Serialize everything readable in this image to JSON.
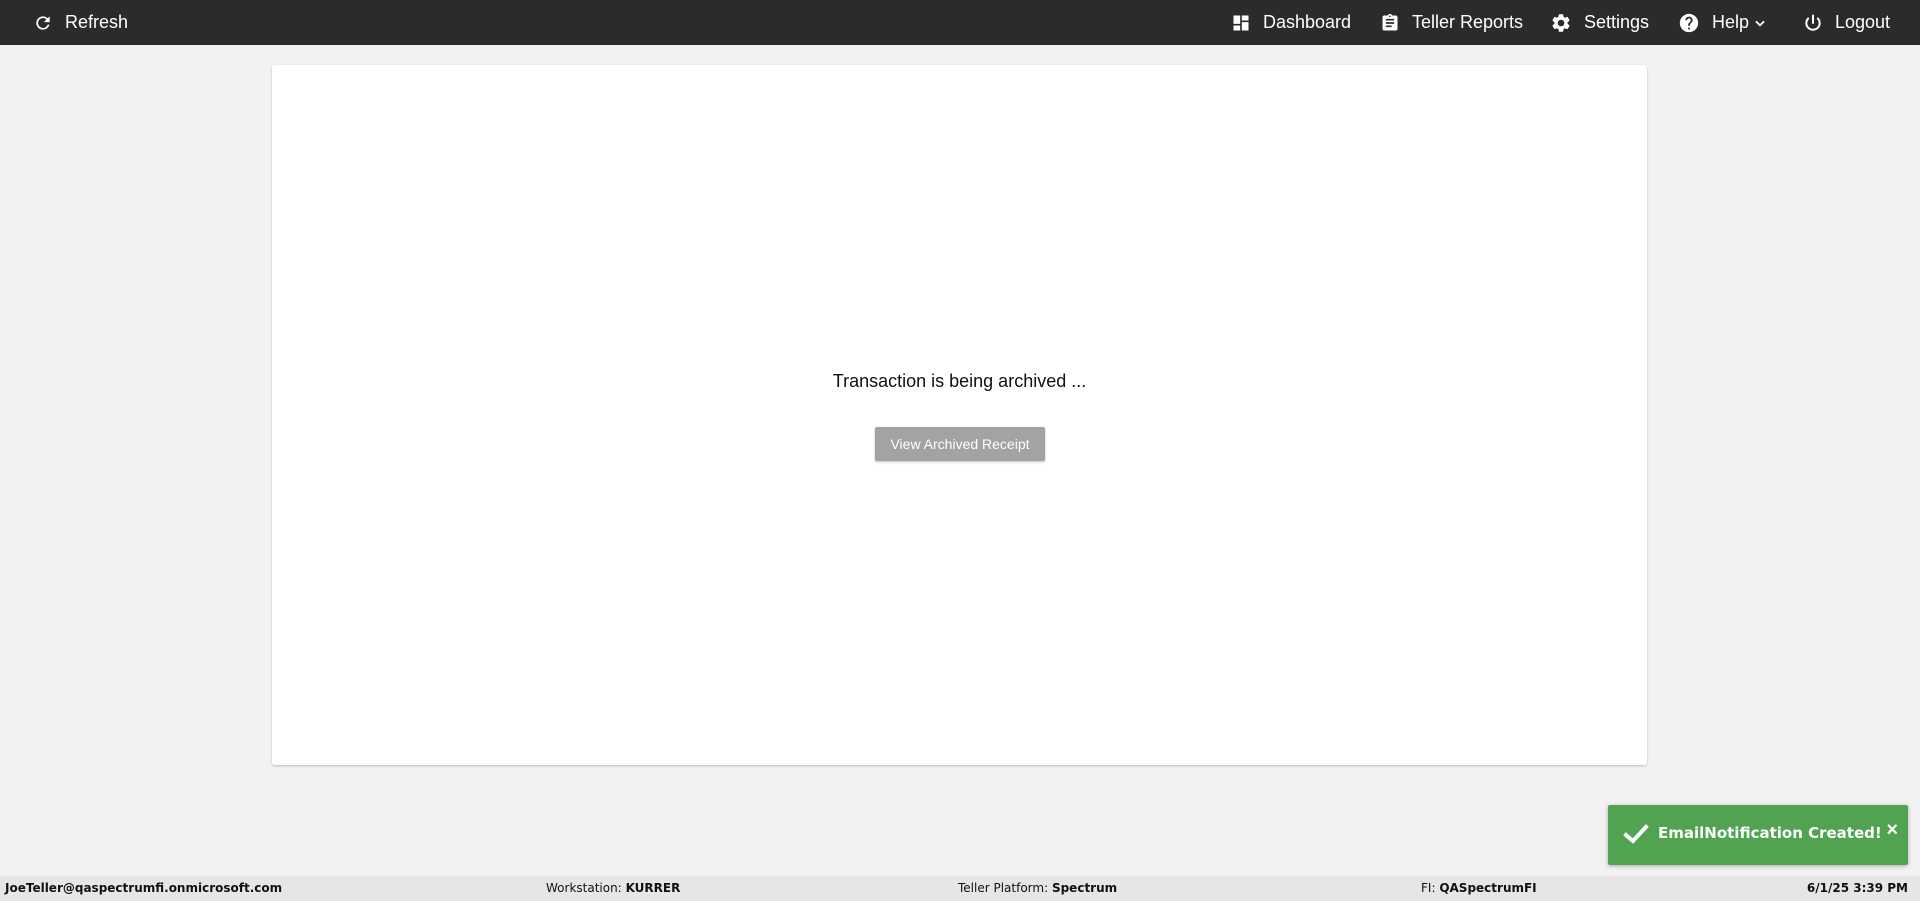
{
  "topbar": {
    "refresh_label": "Refresh",
    "dashboard_label": "Dashboard",
    "reports_label": "Teller Reports",
    "settings_label": "Settings",
    "help_label": "Help",
    "logout_label": "Logout",
    "icons": {
      "refresh": "refresh-icon",
      "dashboard": "dashboard-icon",
      "reports": "clipboard-icon",
      "settings": "gear-icon",
      "help": "help-circle-icon",
      "help_menu": "chevron-down-icon",
      "logout": "power-icon"
    },
    "background_color": "#2b2b2b"
  },
  "main": {
    "status_message": "Transaction is being archived ...",
    "archive_button_label": "View Archived Receipt"
  },
  "toast": {
    "message": "EmailNotification Created!",
    "close_label": "×",
    "icon": "check-icon",
    "background_color": "#51a351"
  },
  "statusbar": {
    "user": "JoeTeller@qaspectrumfi.onmicrosoft.com",
    "workstation_label": "Workstation:",
    "workstation_value": "KURRER",
    "platform_label": "Teller Platform:",
    "platform_value": "Spectrum",
    "fi_label": "FI:",
    "fi_value": "QASpectrumFI",
    "datetime": "6/1/25 3:39 PM"
  }
}
